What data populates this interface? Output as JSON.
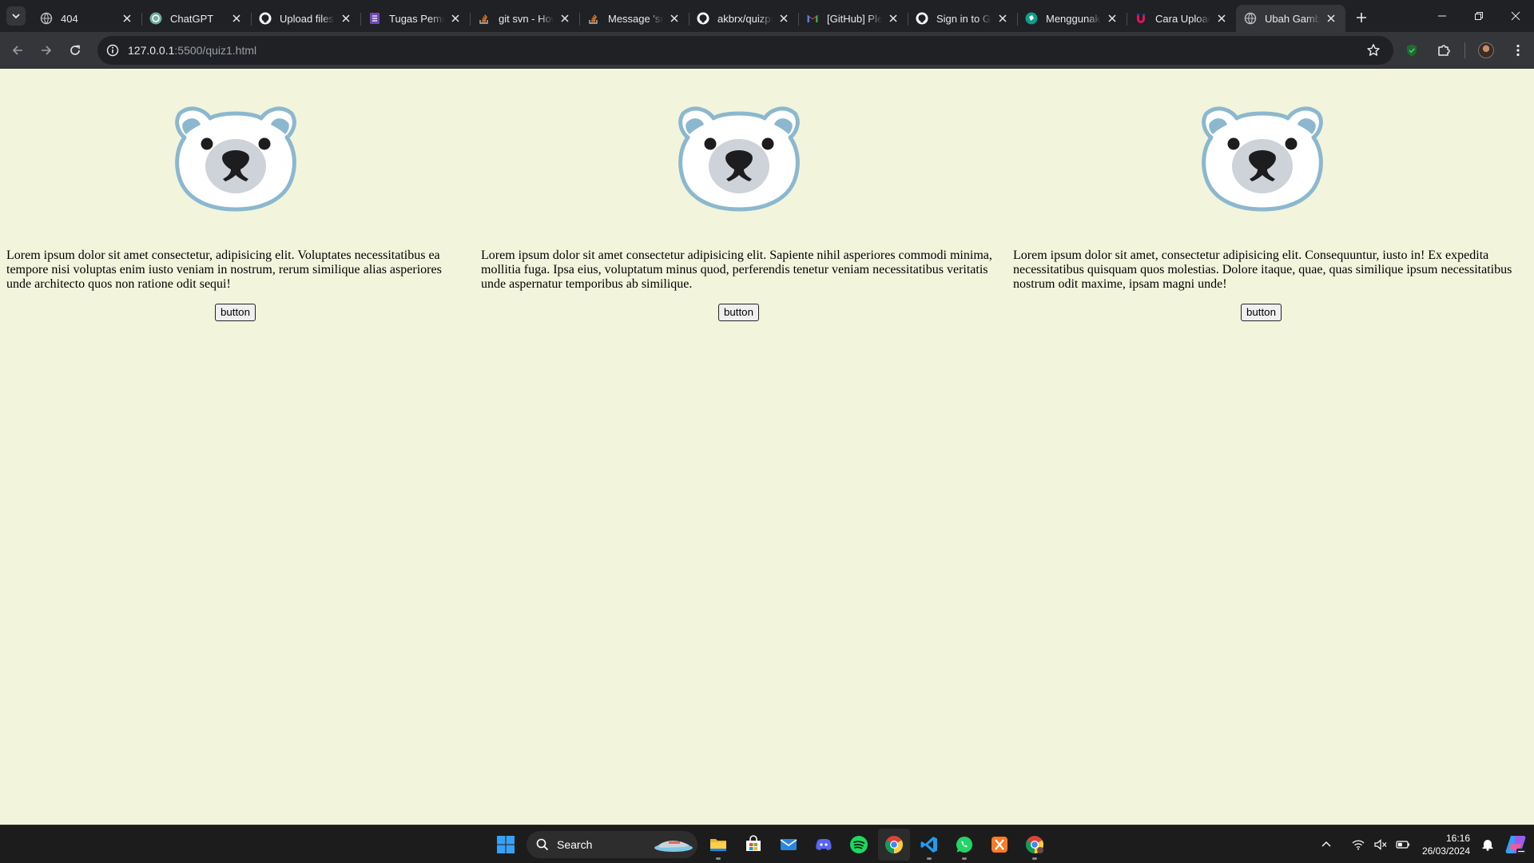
{
  "browser": {
    "tabs": [
      {
        "title": "404",
        "icon": "globe-icon"
      },
      {
        "title": "ChatGPT",
        "icon": "chatgpt-icon"
      },
      {
        "title": "Upload files",
        "icon": "github-icon"
      },
      {
        "title": "Tugas Pemrog",
        "icon": "forms-icon"
      },
      {
        "title": "git svn - How",
        "icon": "stackoverflow-icon"
      },
      {
        "title": "Message 'src",
        "icon": "stackoverflow-icon"
      },
      {
        "title": "akbrx/quizpe",
        "icon": "github-icon"
      },
      {
        "title": "[GitHub] Plea",
        "icon": "gmail-icon"
      },
      {
        "title": "Sign in to Git",
        "icon": "github-icon"
      },
      {
        "title": "Menggunakan",
        "icon": "teal-app-icon"
      },
      {
        "title": "Cara Upload",
        "icon": "magnet-icon"
      },
      {
        "title": "Ubah Gambar",
        "icon": "globe-icon",
        "active": true
      }
    ],
    "url_host": "127.0.0.1",
    "url_rest": ":5500/quiz1.html"
  },
  "page": {
    "cards": [
      {
        "text": "Lorem ipsum dolor sit amet consectetur, adipisicing elit. Voluptates necessitatibus ea tempore nisi voluptas enim iusto veniam in nostrum, rerum similique alias asperiores unde architecto quos non ratione odit sequi!",
        "button_label": "button"
      },
      {
        "text": "Lorem ipsum dolor sit amet consectetur adipisicing elit. Sapiente nihil asperiores commodi minima, mollitia fuga. Ipsa eius, voluptatum minus quod, perferendis tenetur veniam necessitatibus veritatis unde aspernatur temporibus ab similique.",
        "button_label": "button"
      },
      {
        "text": "Lorem ipsum dolor sit amet, consectetur adipisicing elit. Consequuntur, iusto in! Ex expedita necessitatibus quisquam quos molestias. Dolore itaque, quae, quas similique ipsum necessitatibus nostrum odit maxime, ipsam magni unde!",
        "button_label": "button"
      }
    ],
    "image_icon": "polar-bear-icon"
  },
  "taskbar": {
    "search_label": "Search",
    "apps": [
      "file-explorer-icon",
      "microsoft-store-icon",
      "mail-icon",
      "discord-icon",
      "spotify-icon",
      "chrome-icon",
      "vscode-icon",
      "whatsapp-icon",
      "xampp-icon",
      "chrome-profile-icon"
    ],
    "time": "16:16",
    "date": "26/03/2024"
  },
  "colors": {
    "page_background": "#f3f4dc",
    "bear_outline": "#8bb8cf",
    "tab_strip": "#202124",
    "toolbar": "#35363a"
  }
}
